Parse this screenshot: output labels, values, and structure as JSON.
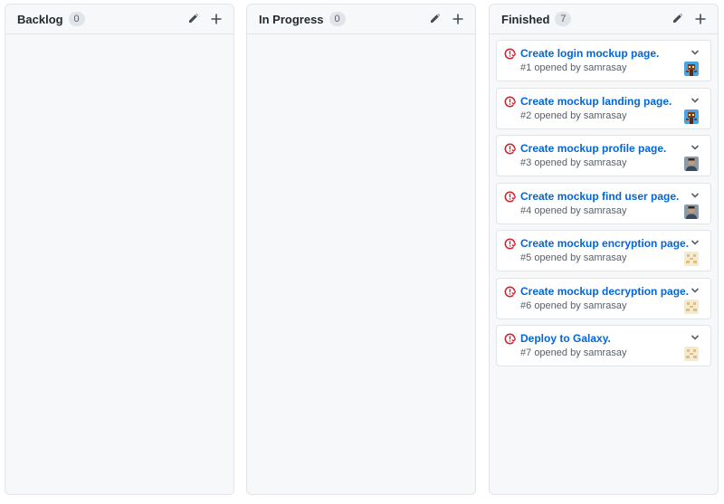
{
  "columns": [
    {
      "title": "Backlog",
      "count": "0"
    },
    {
      "title": "In Progress",
      "count": "0"
    },
    {
      "title": "Finished",
      "count": "7"
    }
  ],
  "cards": [
    {
      "title": "Create login mockup page.",
      "number": "#1",
      "opened_text": "opened by",
      "user": "samrasay",
      "avatar": "robot-avatar"
    },
    {
      "title": "Create mockup landing page.",
      "number": "#2",
      "opened_text": "opened by",
      "user": "samrasay",
      "avatar": "robot-avatar"
    },
    {
      "title": "Create mockup profile page.",
      "number": "#3",
      "opened_text": "opened by",
      "user": "samrasay",
      "avatar": "person-avatar"
    },
    {
      "title": "Create mockup find user page.",
      "number": "#4",
      "opened_text": "opened by",
      "user": "samrasay",
      "avatar": "person-avatar"
    },
    {
      "title": "Create mockup encryption page.",
      "number": "#5",
      "opened_text": "opened by",
      "user": "samrasay",
      "avatar": "identicon-avatar"
    },
    {
      "title": "Create mockup decryption page.",
      "number": "#6",
      "opened_text": "opened by",
      "user": "samrasay",
      "avatar": "identicon-avatar"
    },
    {
      "title": "Deploy to Galaxy.",
      "number": "#7",
      "opened_text": "opened by",
      "user": "samrasay",
      "avatar": "identicon-avatar"
    }
  ],
  "colors": {
    "issue_closed": "#cb2431",
    "link": "#0366d6",
    "column_bg": "#f6f8fa"
  },
  "icons": {
    "edit": "pencil-icon",
    "add": "plus-icon",
    "issue": "issue-closed-icon",
    "expand": "chevron-down-icon"
  }
}
